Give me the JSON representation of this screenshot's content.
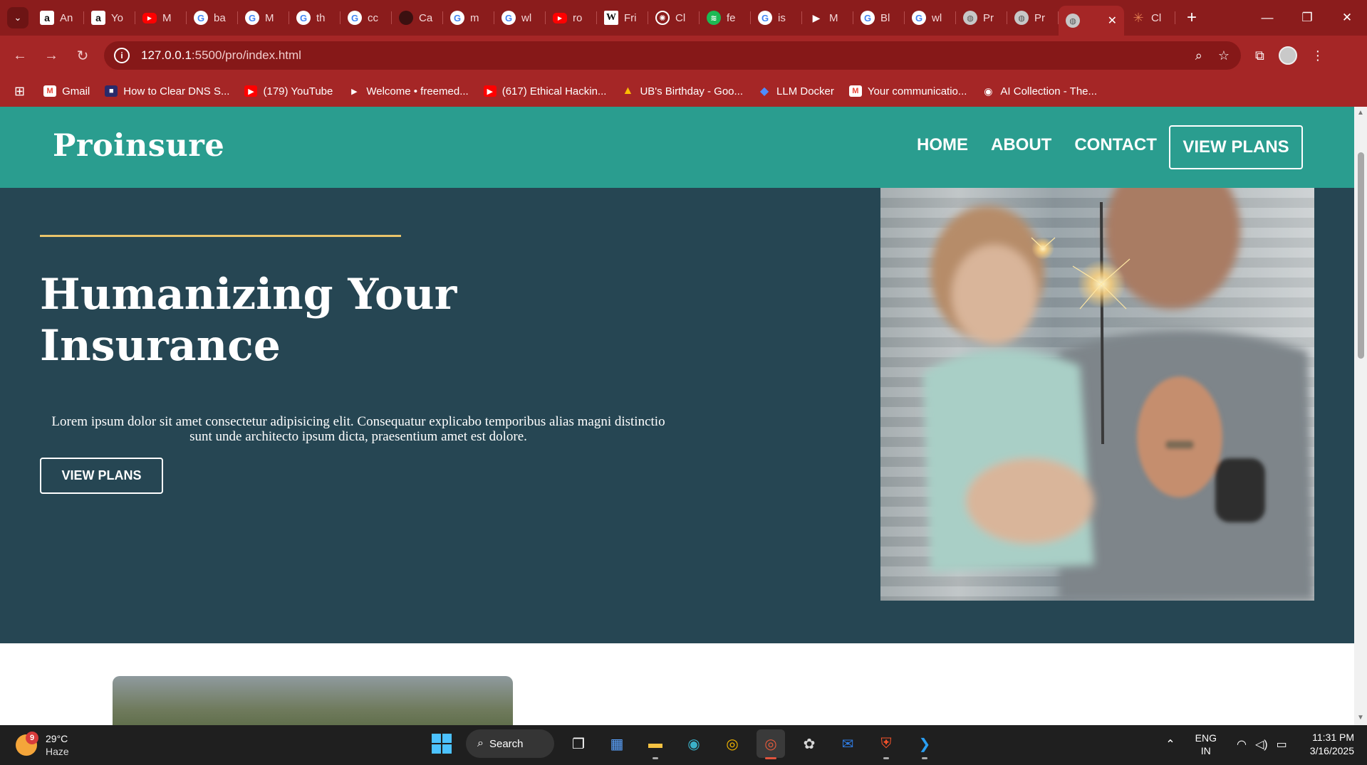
{
  "browser": {
    "tabs": [
      {
        "label": "An",
        "icon": "amazon-icon",
        "glyph": "a",
        "kind": "am"
      },
      {
        "label": "Yo",
        "icon": "amazon-icon",
        "glyph": "a",
        "kind": "am"
      },
      {
        "label": "M",
        "icon": "youtube-icon",
        "glyph": "▶",
        "kind": "yt"
      },
      {
        "label": "ba",
        "icon": "google-icon",
        "glyph": "G",
        "kind": "g"
      },
      {
        "label": "M",
        "icon": "google-icon",
        "glyph": "G",
        "kind": "g"
      },
      {
        "label": "th",
        "icon": "google-icon",
        "glyph": "G",
        "kind": "g"
      },
      {
        "label": "cc",
        "icon": "google-icon",
        "glyph": "G",
        "kind": "g"
      },
      {
        "label": "Ca",
        "icon": "dark-site-icon",
        "glyph": "",
        "kind": "dark"
      },
      {
        "label": "m",
        "icon": "google-icon",
        "glyph": "G",
        "kind": "g"
      },
      {
        "label": "wl",
        "icon": "google-icon",
        "glyph": "G",
        "kind": "g"
      },
      {
        "label": "ro",
        "icon": "youtube-icon",
        "glyph": "▶",
        "kind": "yt"
      },
      {
        "label": "Fri",
        "icon": "wikipedia-icon",
        "glyph": "W",
        "kind": "wiki"
      },
      {
        "label": "Cl",
        "icon": "chatgpt-icon",
        "glyph": "✺",
        "kind": "ai"
      },
      {
        "label": "fe",
        "icon": "spotify-icon",
        "glyph": "≋",
        "kind": "sp"
      },
      {
        "label": "is",
        "icon": "google-icon",
        "glyph": "G",
        "kind": "g"
      },
      {
        "label": "M",
        "icon": "play-icon",
        "glyph": "▶",
        "kind": "play"
      },
      {
        "label": "Bl",
        "icon": "google-icon",
        "glyph": "G",
        "kind": "g"
      },
      {
        "label": "wl",
        "icon": "google-icon",
        "glyph": "G",
        "kind": "g"
      },
      {
        "label": "Pr",
        "icon": "globe-icon",
        "glyph": "◍",
        "kind": "globe"
      },
      {
        "label": "Pr",
        "icon": "globe-icon",
        "glyph": "◍",
        "kind": "globe"
      }
    ],
    "active_tab_icon": "globe-icon",
    "last_tab": {
      "label": "Cl",
      "icon": "claude-icon",
      "glyph": "✳"
    },
    "url_host": "127.0.0.1",
    "url_path": ":5500/pro/index.html",
    "bookmarks": [
      {
        "label": "Gmail",
        "glyph": "M",
        "kind": "gm",
        "icon": "gmail-icon"
      },
      {
        "label": "How to Clear DNS S...",
        "glyph": "■",
        "kind": "dns",
        "icon": "site-icon"
      },
      {
        "label": "(179) YouTube",
        "glyph": "▶",
        "kind": "yt",
        "icon": "youtube-icon"
      },
      {
        "label": "Welcome • freemed...",
        "glyph": "▶",
        "kind": "play",
        "icon": "play-icon"
      },
      {
        "label": "(617) Ethical Hackin...",
        "glyph": "▶",
        "kind": "yt",
        "icon": "youtube-icon"
      },
      {
        "label": "UB's Birthday - Goo...",
        "glyph": "▲",
        "kind": "drive",
        "icon": "google-drive-icon"
      },
      {
        "label": "LLM Docker",
        "glyph": "◆",
        "kind": "docker",
        "icon": "docker-icon"
      },
      {
        "label": "Your communicatio...",
        "glyph": "M",
        "kind": "gm",
        "icon": "gmail-icon"
      },
      {
        "label": "AI Collection - The...",
        "glyph": "◉",
        "kind": "eye",
        "icon": "eye-icon"
      }
    ]
  },
  "site": {
    "logo": "Proinsure",
    "nav": [
      "HOME",
      "ABOUT",
      "CONTACT"
    ],
    "nav_cta": "VIEW PLANS",
    "hero_title": "Humanizing Your Insurance",
    "hero_text": "Lorem ipsum dolor sit amet consectetur adipisicing elit. Consequatur explicabo temporibus alias magni distinctio sunt unde architecto ipsum dicta, praesentium amet est dolore.",
    "hero_cta": "VIEW PLANS"
  },
  "taskbar": {
    "temperature": "29°C",
    "condition": "Haze",
    "weather_badge": "9",
    "search_label": "Search",
    "lang_top": "ENG",
    "lang_bottom": "IN",
    "time": "11:31 PM",
    "date": "3/16/2025"
  },
  "colors": {
    "browser_frame": "#8b1c1c",
    "toolbar": "#a52626",
    "header_teal": "#2a9d8f",
    "hero_navy": "#264653",
    "accent_gold": "#e9c46a"
  }
}
